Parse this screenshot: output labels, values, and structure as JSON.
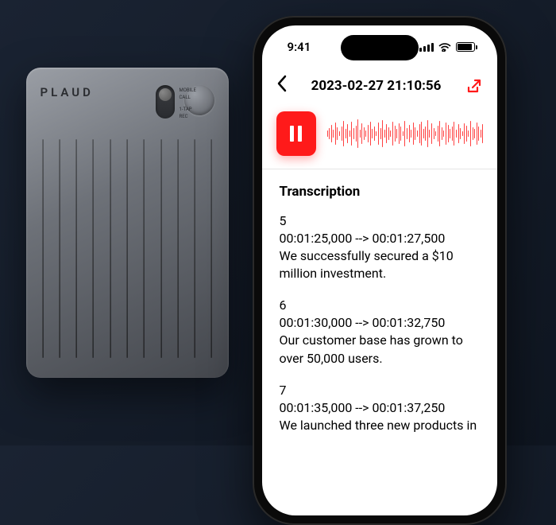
{
  "device": {
    "brand": "PLAUD",
    "slider_top": "MOBILE",
    "slider_mid": "CALL",
    "slider_bot": "1-TAP",
    "slider_bot2": "REC"
  },
  "status": {
    "time": "9:41"
  },
  "nav": {
    "title": "2023-02-27 21:10:56"
  },
  "transcription": {
    "title": "Transcription",
    "segments": [
      {
        "index": "5",
        "time": "00:01:25,000 --> 00:01:27,500",
        "text": "We successfully secured a $10 million investment."
      },
      {
        "index": "6",
        "time": "00:01:30,000 --> 00:01:32,750",
        "text": "Our customer base has grown to over 50,000 users."
      },
      {
        "index": "7",
        "time": "00:01:35,000 --> 00:01:37,250",
        "text": "We launched three new products in"
      }
    ]
  },
  "waveform_heights": [
    8,
    14,
    22,
    10,
    28,
    16,
    6,
    18,
    32,
    12,
    24,
    8,
    30,
    14,
    20,
    36,
    10,
    26,
    16,
    8,
    22,
    30,
    12,
    18,
    6,
    28,
    14,
    34,
    10,
    24,
    16,
    8,
    30,
    20,
    12,
    26,
    18,
    6,
    32,
    14,
    22,
    10,
    28,
    16,
    8,
    24,
    30,
    12,
    18,
    34,
    10,
    26,
    14,
    6,
    20,
    32,
    16,
    8,
    28,
    22,
    12,
    18,
    30,
    10,
    24,
    14,
    6,
    26,
    20,
    8,
    32,
    16,
    12,
    28,
    18,
    10,
    24
  ],
  "colors": {
    "accent": "#ff1a1a",
    "background": "#1a2332",
    "device": "#6d7178"
  }
}
